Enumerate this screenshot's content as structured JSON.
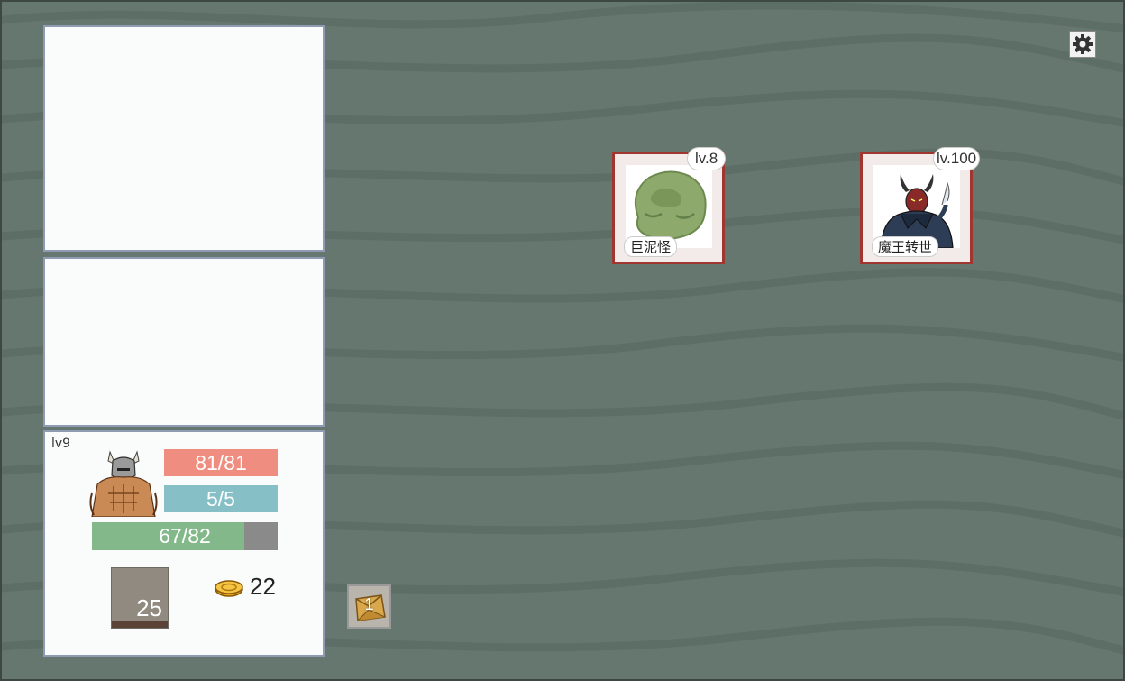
{
  "player": {
    "level": "lv9",
    "hp": "81/81",
    "mp": "5/5",
    "xp": "67/82",
    "xp_fraction": 0.82,
    "deck_count": "25",
    "gold": "22",
    "avatar_icon": "horned-warrior-avatar"
  },
  "inbox": {
    "count": "1",
    "icon": "treasure-box-icon"
  },
  "settings": {
    "icon": "gear-icon"
  },
  "enemies": [
    {
      "name": "巨泥怪",
      "level": "lv.8",
      "icon": "green-slime-icon"
    },
    {
      "name": "魔王转世",
      "level": "lv.100",
      "icon": "demon-lord-icon"
    }
  ],
  "colors": {
    "background": "#66776f",
    "hp_bar": "#ee8d80",
    "mp_bar": "#86bfc6",
    "xp_bar": "#83b98a",
    "enemy_frame": "#a0362f"
  }
}
